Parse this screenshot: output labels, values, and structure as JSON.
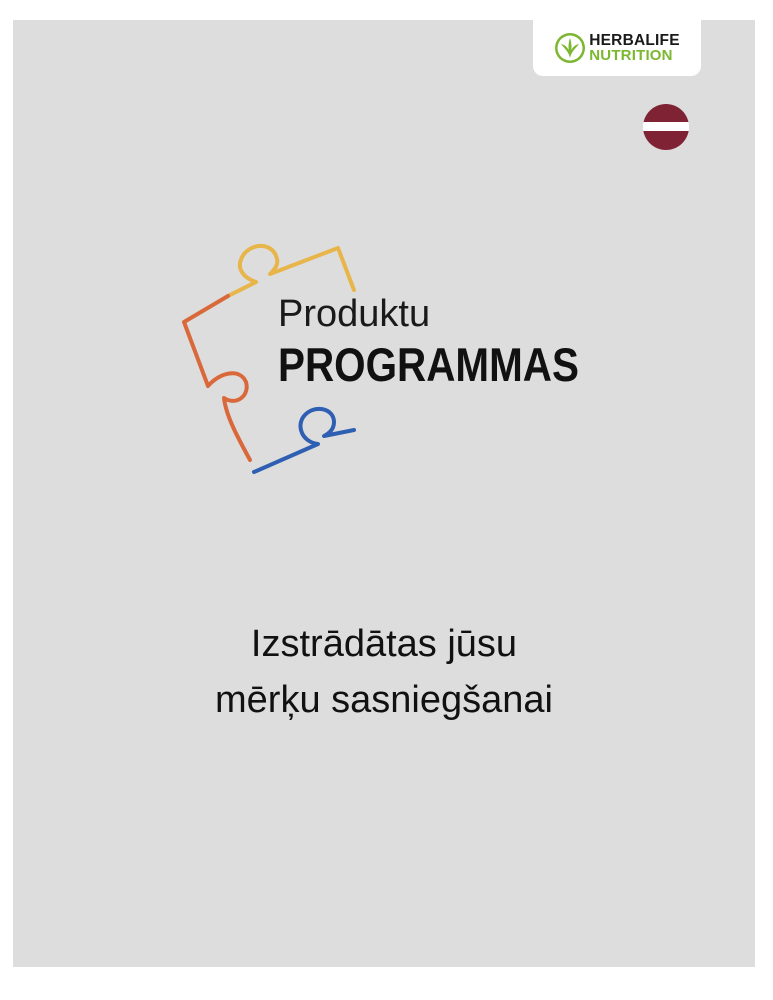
{
  "brand": {
    "line1": "HERBALIFE",
    "line2": "NUTRITION",
    "accent_color": "#7bb72f"
  },
  "flag": {
    "icon": "latvia-flag-icon",
    "colors": [
      "#7f2334",
      "#ffffff",
      "#7f2334"
    ]
  },
  "program_logo": {
    "title_line1": "Produktu",
    "title_line2": "PROGRAMMAS",
    "puzzle_colors": [
      "#e8b54a",
      "#d9693a",
      "#2f5fb3"
    ]
  },
  "tagline": {
    "line1": "Izstrādātas jūsu",
    "line2": "mērķu sasniegšanai"
  }
}
